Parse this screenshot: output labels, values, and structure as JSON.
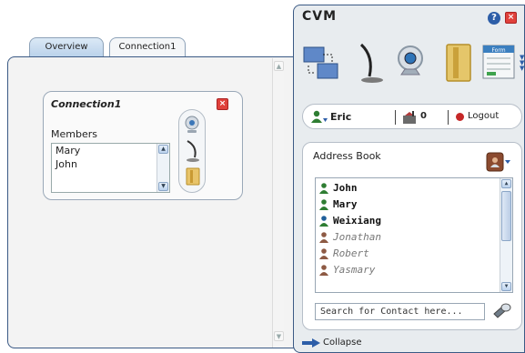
{
  "tabs": [
    {
      "label": "Overview",
      "active": true
    },
    {
      "label": "Connection1",
      "active": false
    }
  ],
  "connection_card": {
    "title": "Connection1",
    "members_label": "Members",
    "members": [
      "Mary",
      "John"
    ]
  },
  "cvm": {
    "title": "CVM",
    "toolbar": [
      "screen-share-icon",
      "microphone-icon",
      "webcam-icon",
      "folder-icon",
      "form-icon"
    ],
    "form_icon_text": "Form",
    "user": "Eric",
    "message_count": "0",
    "logout_label": "Logout",
    "address_book": {
      "title": "Address Book",
      "contacts": [
        {
          "name": "John",
          "status": "online"
        },
        {
          "name": "Mary",
          "status": "online"
        },
        {
          "name": "Weixiang",
          "status": "online"
        },
        {
          "name": "Jonathan",
          "status": "offline"
        },
        {
          "name": "Robert",
          "status": "offline"
        },
        {
          "name": "Yasmary",
          "status": "offline"
        }
      ],
      "search_placeholder": "Search for Contact here..."
    },
    "collapse_label": "Collapse"
  },
  "colors": {
    "accent_blue": "#3b5a85",
    "close_red": "#e0413b",
    "online_green": "#2e7d32",
    "offline_brown": "#8d5a44"
  }
}
